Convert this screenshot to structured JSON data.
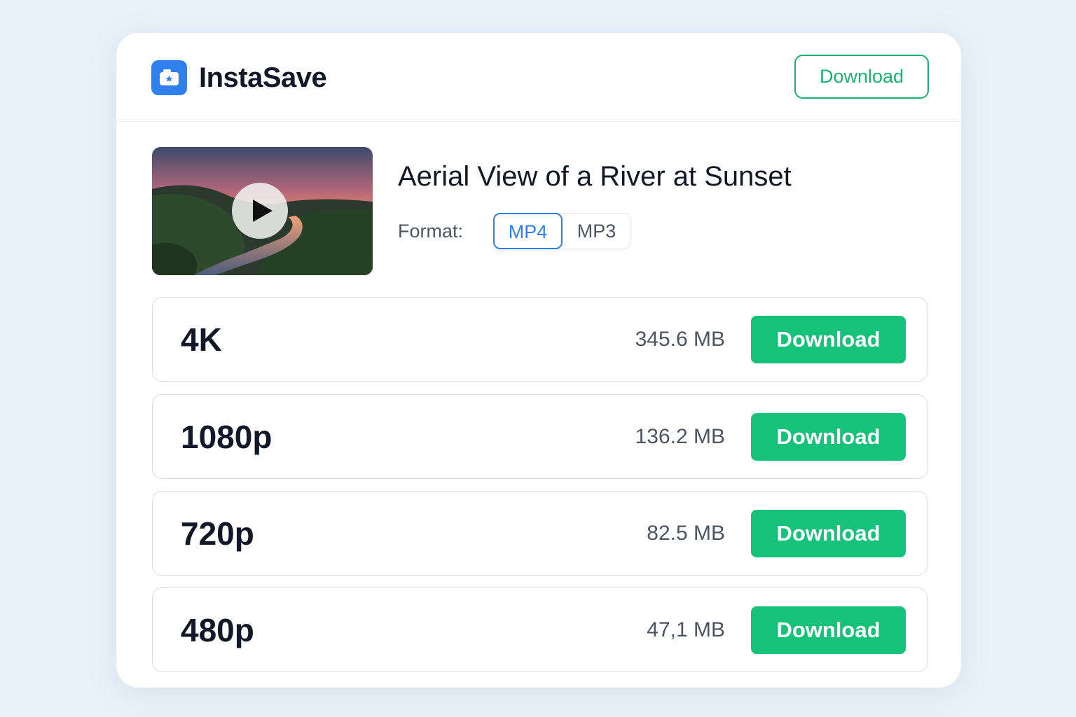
{
  "app": {
    "brand": "InstaSave",
    "logo_icon": "camera-icon",
    "accent_color": "#2f80ed",
    "success_color": "#16c27a"
  },
  "header": {
    "download_label": "Download"
  },
  "video": {
    "title": "Aerial View of a River at Sunset",
    "thumbnail_icon": "play-icon"
  },
  "format": {
    "label": "Format:",
    "options": [
      "MP4",
      "MP3"
    ],
    "selected": "MP4"
  },
  "qualities": [
    {
      "resolution": "4K",
      "size": "345.6 MB",
      "button": "Download"
    },
    {
      "resolution": "1080p",
      "size": "136.2 MB",
      "button": "Download"
    },
    {
      "resolution": "720p",
      "size": "82.5 MB",
      "button": "Download"
    },
    {
      "resolution": "480p",
      "size": "47,1 MB",
      "button": "Download"
    }
  ]
}
